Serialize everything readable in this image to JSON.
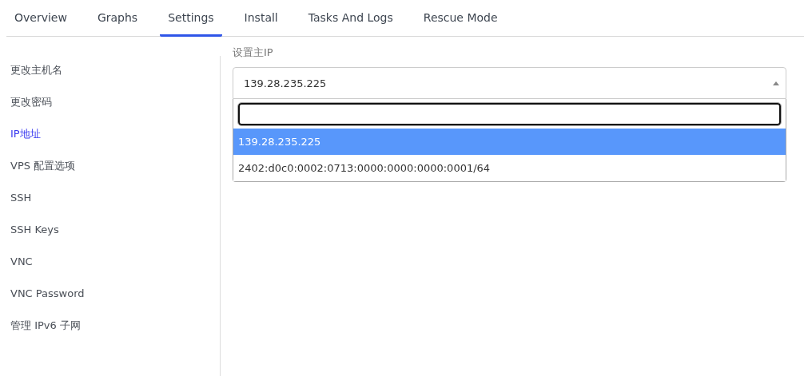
{
  "tabs": [
    {
      "label": "Overview",
      "selected": false
    },
    {
      "label": "Graphs",
      "selected": false
    },
    {
      "label": "Settings",
      "selected": true
    },
    {
      "label": "Install",
      "selected": false
    },
    {
      "label": "Tasks And Logs",
      "selected": false
    },
    {
      "label": "Rescue Mode",
      "selected": false
    }
  ],
  "sidebar": {
    "items": [
      {
        "label": "更改主机名",
        "selected": false
      },
      {
        "label": "更改密码",
        "selected": false
      },
      {
        "label": "IP地址",
        "selected": true
      },
      {
        "label": "VPS 配置选项",
        "selected": false
      },
      {
        "label": "SSH",
        "selected": false
      },
      {
        "label": "SSH Keys",
        "selected": false
      },
      {
        "label": "VNC",
        "selected": false
      },
      {
        "label": "VNC Password",
        "selected": false
      },
      {
        "label": "管理 IPv6 子网",
        "selected": false
      }
    ]
  },
  "form": {
    "label": "设置主IP",
    "select": {
      "value": "139.28.235.225",
      "expanded": true,
      "options": [
        {
          "label": "139.28.235.225",
          "selected": true
        },
        {
          "label": "2402:d0c0:0002:0713:0000:0000:0000:0001/64",
          "selected": false
        }
      ]
    }
  }
}
